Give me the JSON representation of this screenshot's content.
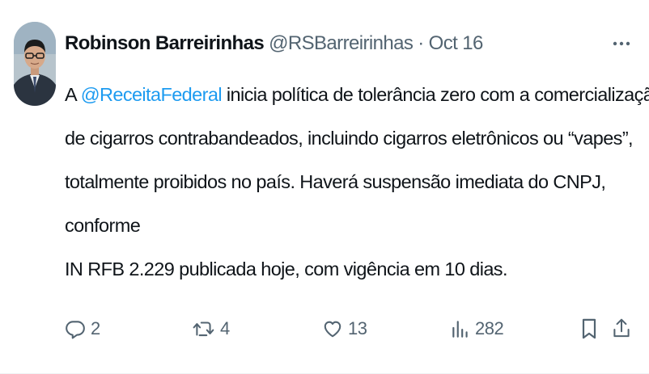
{
  "author": {
    "display_name": "Robinson Barreirinhas",
    "handle": "@RSBarreirinhas",
    "separator": "·",
    "date": "Oct 16",
    "avatar_icon": "profile-photo"
  },
  "tweet": {
    "line1_before": "A ",
    "mention": "@ReceitaFederal",
    "line1_after": " inicia política de tolerância zero com a comercialização",
    "line2": "de cigarros contrabandeados, incluindo cigarros eletrônicos ou “vapes”,",
    "line3": "totalmente proibidos no país. Haverá suspensão imediata do CNPJ,",
    "line4": "conforme",
    "line5": "IN RFB 2.229 publicada hoje, com vigência em 10 dias."
  },
  "actions": {
    "replies": "2",
    "retweets": "4",
    "likes": "13",
    "views": "282"
  },
  "colors": {
    "text": "#0f1419",
    "secondary": "#536471",
    "link": "#1d9bf0",
    "divider": "#eff3f4"
  }
}
